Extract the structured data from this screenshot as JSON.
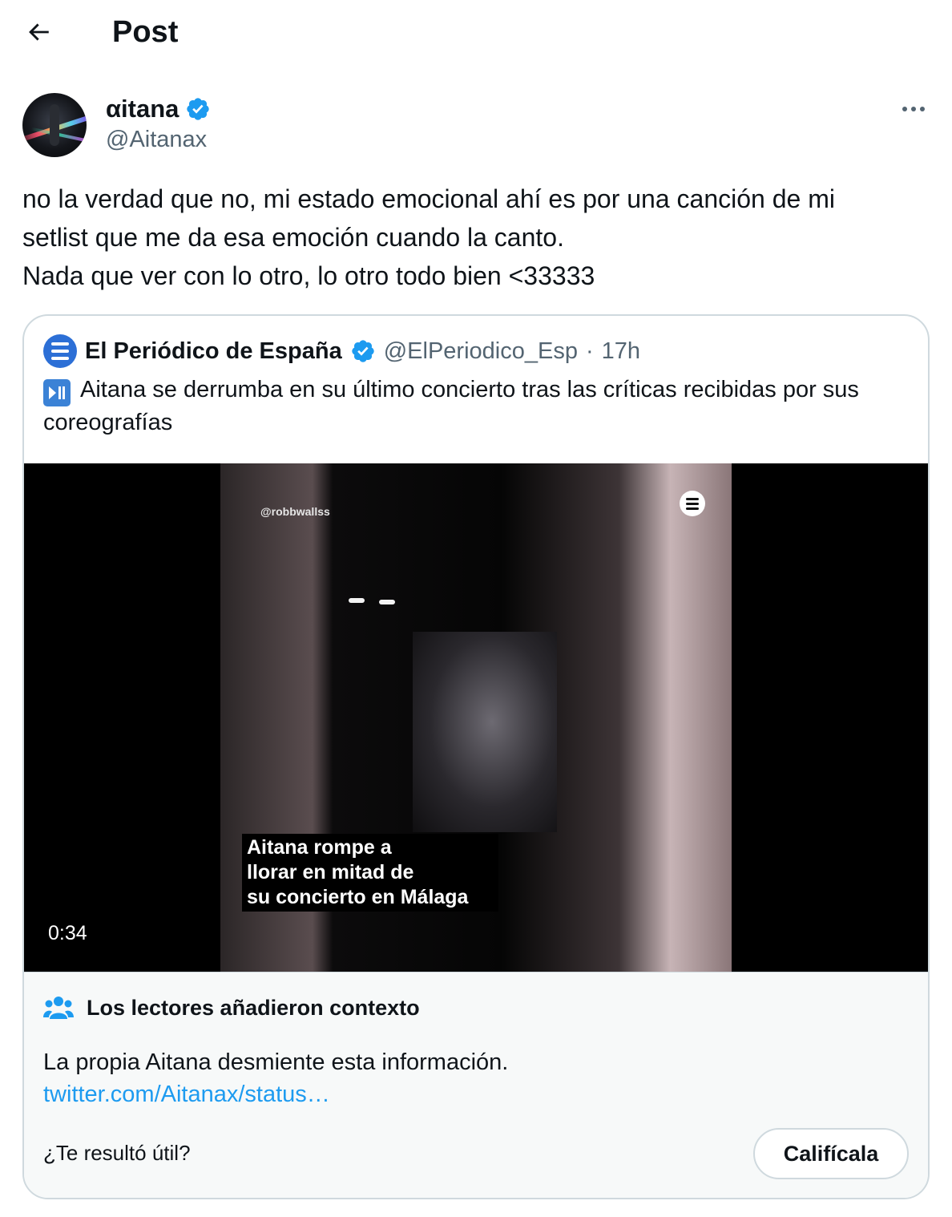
{
  "header": {
    "title": "Post"
  },
  "author": {
    "name": "αitana",
    "handle": "@Aitanax"
  },
  "tweet": {
    "lines": [
      "no la verdad que no, mi estado emocional ahí es por una canción de mi",
      "setlist que me da esa emoción cuando la canto.",
      "Nada que ver con lo otro, lo otro todo bien <33333"
    ]
  },
  "quote": {
    "name": "El Periódico de España",
    "handle": "@ElPeriodico_Esp",
    "separator": "·",
    "time": "17h",
    "text": "Aitana se derrumba en su último concierto tras las críticas recibidas por sus coreografías",
    "video": {
      "watermark": "@robbwallss",
      "caption": [
        "Aitana rompe a",
        "llorar en mitad de",
        "su concierto en Málaga"
      ],
      "duration": "0:34"
    }
  },
  "community_note": {
    "title": "Los lectores añadieron contexto",
    "body": "La propia Aitana desmiente esta información.",
    "link": "twitter.com/Aitanax/status…",
    "question": "¿Te resultó útil?",
    "rate_label": "Califícala"
  },
  "colors": {
    "verified": "#1d9bf0",
    "link": "#1d9bf0",
    "secondary_text": "#536471",
    "border": "#cfd9de"
  },
  "icons": [
    "back-arrow-icon",
    "verified-badge-icon",
    "more-icon",
    "periodico-logo-icon",
    "play-pause-icon",
    "people-icon"
  ]
}
